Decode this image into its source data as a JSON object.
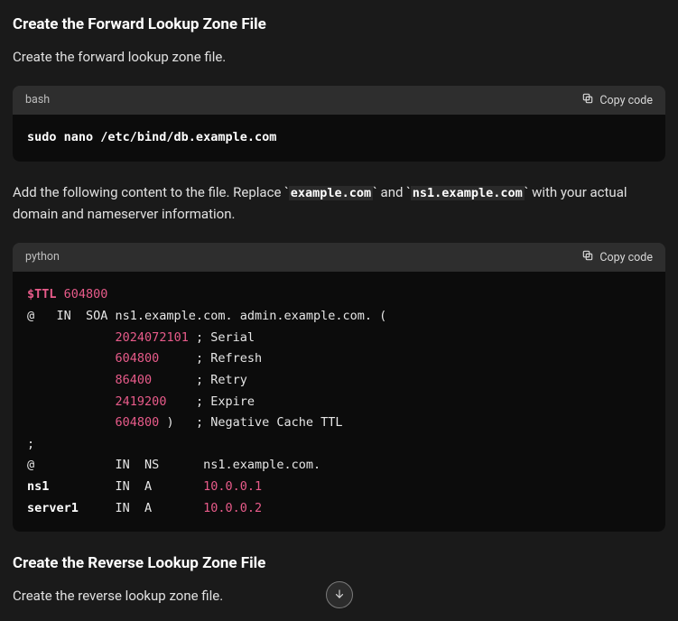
{
  "section1": {
    "title": "Create the Forward Lookup Zone File",
    "intro": "Create the forward lookup zone file.",
    "paragraph_prefix": "Add the following content to the file. Replace ",
    "inline1": "example.com",
    "paragraph_mid": " and ",
    "inline2": "ns1.example.com",
    "paragraph_suffix": " with your actual domain and nameserver information."
  },
  "section2": {
    "title": "Create the Reverse Lookup Zone File",
    "intro": "Create the reverse lookup zone file."
  },
  "codeblock1": {
    "lang": "bash",
    "copy_label": "Copy code",
    "content": "sudo nano /etc/bind/db.example.com"
  },
  "codeblock2": {
    "lang": "python",
    "copy_label": "Copy code",
    "ttl_var": "$TTL",
    "ttl_val": "604800",
    "line2_pre": "@   IN  SOA ns1.example.com. admin.example.com. (",
    "serial": "2024072101",
    "serial_c": "; Serial",
    "refresh": "604800",
    "refresh_c": "; Refresh",
    "retry": "86400",
    "retry_c": "; Retry",
    "expire": "2419200",
    "expire_c": "; Expire",
    "negttl": "604800",
    "negttl_c": ")   ; Negative Cache TTL",
    "semi": ";",
    "nsline_pre": "@           IN  NS      ns1.example.com.",
    "ns1_label": "ns1",
    "ns1_rec": "IN  A       ",
    "ns1_ip": "10.0.0.1",
    "srv_label": "server1",
    "srv_rec": "IN  A       ",
    "srv_ip": "10.0.0.2"
  }
}
